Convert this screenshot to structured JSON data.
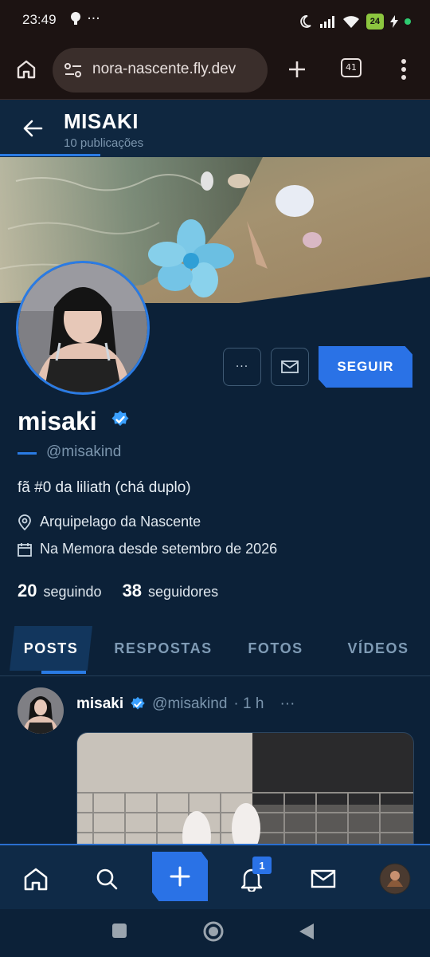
{
  "status_bar": {
    "time": "23:49",
    "extra": "···",
    "battery": "24"
  },
  "browser": {
    "url": "nora-nascente.fly.dev",
    "tab_count": "41"
  },
  "header": {
    "title": "MISAKI",
    "subtitle": "10 publicações"
  },
  "profile": {
    "display_name": "misaki",
    "handle": "@misakind",
    "bio": "fã #0 da liliath (chá duplo)",
    "location": "Arquipelago da Nascente",
    "joined": "Na Memora desde setembro de 2026",
    "following_count": "20",
    "following_label": "seguindo",
    "followers_count": "38",
    "followers_label": "seguidores",
    "follow_label": "SEGUIR",
    "more_label": "···"
  },
  "tabs": [
    {
      "label": "POSTS"
    },
    {
      "label": "RESPOSTAS"
    },
    {
      "label": "FOTOS"
    },
    {
      "label": "VÍDEOS"
    }
  ],
  "post": {
    "name": "misaki",
    "handle": "@misakind",
    "time": "· 1 h",
    "more": "···"
  },
  "nav": {
    "notification_count": "1"
  },
  "colors": {
    "accent": "#2a72e6",
    "background": "#0c2138",
    "verified": "#3aa0ff"
  }
}
